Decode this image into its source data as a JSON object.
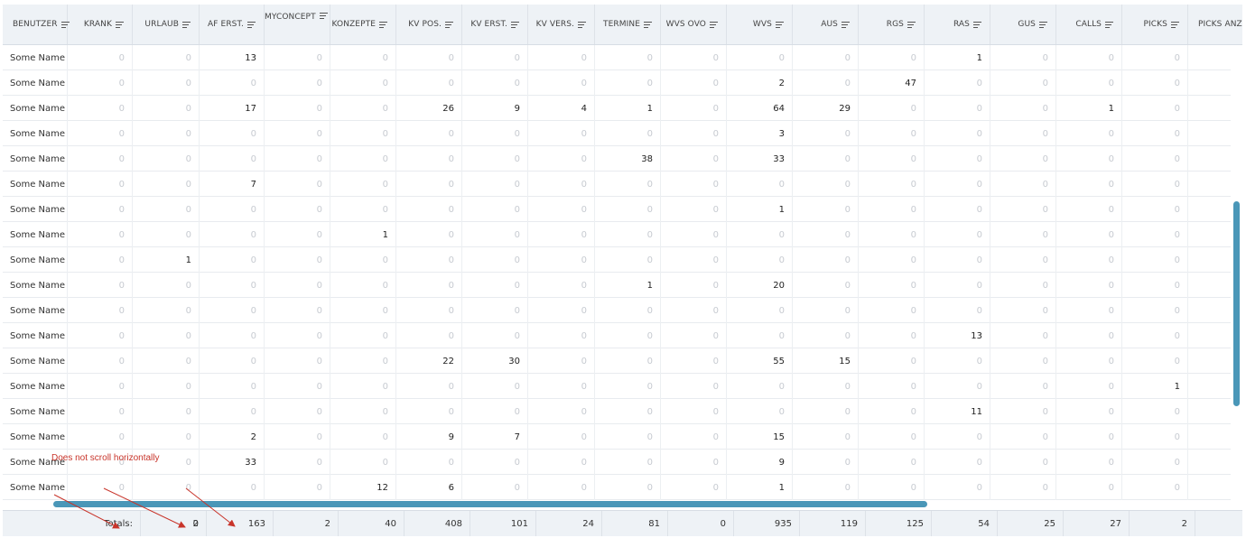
{
  "columns": [
    {
      "label": "BENUTZER",
      "has_menu": true
    },
    {
      "label": "KRANK",
      "has_menu": true
    },
    {
      "label": "URLAUB",
      "has_menu": true
    },
    {
      "label": "AF ERST.",
      "has_menu": true
    },
    {
      "label": "MYCONCEPT",
      "has_menu": true
    },
    {
      "label": "KONZEPTE",
      "has_menu": true
    },
    {
      "label": "KV POS.",
      "has_menu": true
    },
    {
      "label": "KV ERST.",
      "has_menu": true
    },
    {
      "label": "KV VERS.",
      "has_menu": true
    },
    {
      "label": "TERMINE",
      "has_menu": true
    },
    {
      "label": "WVS OVO",
      "has_menu": true
    },
    {
      "label": "WVS",
      "has_menu": true
    },
    {
      "label": "AUS",
      "has_menu": true
    },
    {
      "label": "RGS",
      "has_menu": true
    },
    {
      "label": "RAS",
      "has_menu": true
    },
    {
      "label": "GUS",
      "has_menu": true
    },
    {
      "label": "CALLS",
      "has_menu": true
    },
    {
      "label": "PICKS",
      "has_menu": true
    },
    {
      "label": "PICKS ANZ.",
      "has_menu": false
    }
  ],
  "rows": [
    {
      "name": "Some Name",
      "values": [
        "0",
        "0",
        "13",
        "0",
        "0",
        "0",
        "0",
        "0",
        "0",
        "0",
        "0",
        "0",
        "0",
        "1",
        "0",
        "0",
        "0"
      ]
    },
    {
      "name": "Some Name",
      "values": [
        "0",
        "0",
        "0",
        "0",
        "0",
        "0",
        "0",
        "0",
        "0",
        "0",
        "2",
        "0",
        "47",
        "0",
        "0",
        "0",
        "0"
      ]
    },
    {
      "name": "Some Name",
      "values": [
        "0",
        "0",
        "17",
        "0",
        "0",
        "26",
        "9",
        "4",
        "1",
        "0",
        "64",
        "29",
        "0",
        "0",
        "0",
        "1",
        "0"
      ]
    },
    {
      "name": "Some Name",
      "values": [
        "0",
        "0",
        "0",
        "0",
        "0",
        "0",
        "0",
        "0",
        "0",
        "0",
        "3",
        "0",
        "0",
        "0",
        "0",
        "0",
        "0"
      ]
    },
    {
      "name": "Some Name",
      "values": [
        "0",
        "0",
        "0",
        "0",
        "0",
        "0",
        "0",
        "0",
        "38",
        "0",
        "33",
        "0",
        "0",
        "0",
        "0",
        "0",
        "0"
      ]
    },
    {
      "name": "Some Name",
      "values": [
        "0",
        "0",
        "7",
        "0",
        "0",
        "0",
        "0",
        "0",
        "0",
        "0",
        "0",
        "0",
        "0",
        "0",
        "0",
        "0",
        "0"
      ]
    },
    {
      "name": "Some Name",
      "values": [
        "0",
        "0",
        "0",
        "0",
        "0",
        "0",
        "0",
        "0",
        "0",
        "0",
        "1",
        "0",
        "0",
        "0",
        "0",
        "0",
        "0"
      ]
    },
    {
      "name": "Some Name",
      "values": [
        "0",
        "0",
        "0",
        "0",
        "1",
        "0",
        "0",
        "0",
        "0",
        "0",
        "0",
        "0",
        "0",
        "0",
        "0",
        "0",
        "0"
      ]
    },
    {
      "name": "Some Name",
      "values": [
        "0",
        "1",
        "0",
        "0",
        "0",
        "0",
        "0",
        "0",
        "0",
        "0",
        "0",
        "0",
        "0",
        "0",
        "0",
        "0",
        "0"
      ]
    },
    {
      "name": "Some Name",
      "values": [
        "0",
        "0",
        "0",
        "0",
        "0",
        "0",
        "0",
        "0",
        "1",
        "0",
        "20",
        "0",
        "0",
        "0",
        "0",
        "0",
        "0"
      ]
    },
    {
      "name": "Some Name",
      "values": [
        "0",
        "0",
        "0",
        "0",
        "0",
        "0",
        "0",
        "0",
        "0",
        "0",
        "0",
        "0",
        "0",
        "0",
        "0",
        "0",
        "0"
      ]
    },
    {
      "name": "Some Name",
      "values": [
        "0",
        "0",
        "0",
        "0",
        "0",
        "0",
        "0",
        "0",
        "0",
        "0",
        "0",
        "0",
        "0",
        "13",
        "0",
        "0",
        "0"
      ]
    },
    {
      "name": "Some Name",
      "values": [
        "0",
        "0",
        "0",
        "0",
        "0",
        "22",
        "30",
        "0",
        "0",
        "0",
        "55",
        "15",
        "0",
        "0",
        "0",
        "0",
        "0"
      ]
    },
    {
      "name": "Some Name",
      "values": [
        "0",
        "0",
        "0",
        "0",
        "0",
        "0",
        "0",
        "0",
        "0",
        "0",
        "0",
        "0",
        "0",
        "0",
        "0",
        "0",
        "1"
      ]
    },
    {
      "name": "Some Name",
      "values": [
        "0",
        "0",
        "0",
        "0",
        "0",
        "0",
        "0",
        "0",
        "0",
        "0",
        "0",
        "0",
        "0",
        "11",
        "0",
        "0",
        "0"
      ]
    },
    {
      "name": "Some Name",
      "values": [
        "0",
        "0",
        "2",
        "0",
        "0",
        "9",
        "7",
        "0",
        "0",
        "0",
        "15",
        "0",
        "0",
        "0",
        "0",
        "0",
        "0"
      ]
    },
    {
      "name": "Some Name",
      "values": [
        "0",
        "0",
        "33",
        "0",
        "0",
        "0",
        "0",
        "0",
        "0",
        "0",
        "9",
        "0",
        "0",
        "0",
        "0",
        "0",
        "0"
      ]
    },
    {
      "name": "Some Name",
      "values": [
        "0",
        "0",
        "0",
        "0",
        "12",
        "6",
        "0",
        "0",
        "0",
        "0",
        "1",
        "0",
        "0",
        "0",
        "0",
        "0",
        "0"
      ]
    }
  ],
  "footer": {
    "label": "Totals:",
    "values": [
      "0",
      "2",
      "163",
      "2",
      "40",
      "408",
      "101",
      "24",
      "81",
      "0",
      "935",
      "119",
      "125",
      "54",
      "25",
      "27",
      "2"
    ]
  },
  "annotation": {
    "text": "Does not scroll horizontally",
    "color": "#c8342a"
  },
  "colors": {
    "header_bg": "#eef2f6",
    "scrollbar": "#4a97b8",
    "zero_text": "#c7cbd1"
  }
}
